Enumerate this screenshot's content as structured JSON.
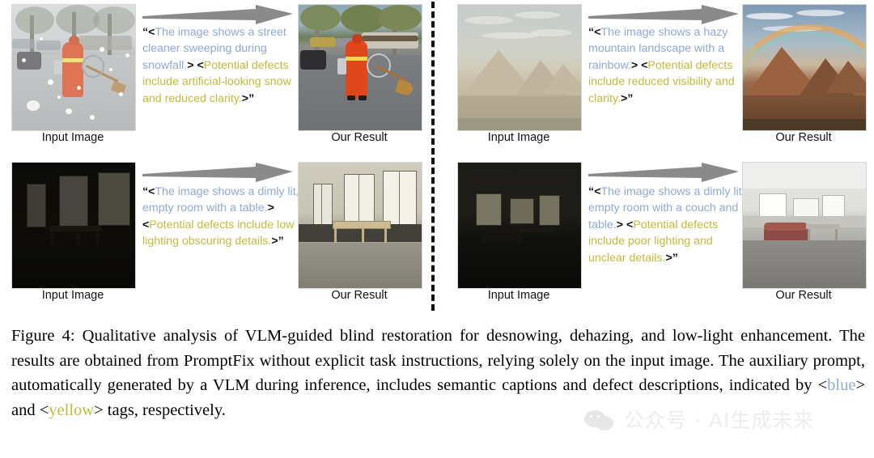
{
  "figure": {
    "panels": [
      {
        "id": "desnowing",
        "input_label": "Input Image",
        "result_label": "Our Result",
        "prompt": {
          "open_quote": "“",
          "caption_open": "<",
          "caption_text": "The image shows a street cleaner sweeping during snowfall.",
          "caption_close": ">",
          "defect_open": "<",
          "defect_text": "Potential defects include artificial-looking snow and reduced clarity.",
          "defect_close": ">",
          "close_quote": "”"
        }
      },
      {
        "id": "dehazing",
        "input_label": "Input Image",
        "result_label": "Our Result",
        "prompt": {
          "open_quote": "“",
          "caption_open": "<",
          "caption_text": "The image shows a hazy mountain landscape with a rainbow.",
          "caption_close": ">",
          "defect_open": "<",
          "defect_text": "Potential defects include reduced visibility and clarity.",
          "defect_close": ">",
          "close_quote": "”"
        }
      },
      {
        "id": "lowlight-table",
        "input_label": "Input Image",
        "result_label": "Our Result",
        "prompt": {
          "open_quote": "“",
          "caption_open": "<",
          "caption_text": "The image shows a dimly lit, empty room with a table.",
          "caption_close": ">",
          "defect_open": "<",
          "defect_text": "Potential defects include low lighting obscuring details.",
          "defect_close": ">",
          "close_quote": "”"
        }
      },
      {
        "id": "lowlight-couch",
        "input_label": "Input Image",
        "result_label": "Our Result",
        "prompt": {
          "open_quote": "“",
          "caption_open": "<",
          "caption_text": "The image shows a dimly lit, empty room with a couch and table.",
          "caption_close": ">",
          "defect_open": "<",
          "defect_text": "Potential defects include poor lighting and unclear details.",
          "defect_close": ">",
          "close_quote": "”"
        }
      }
    ]
  },
  "caption": {
    "part1": "Figure 4: Qualitative analysis of VLM-guided blind restoration for desnowing, dehazing, and low-light enhancement.  The results are obtained from PromptFix without explicit task instructions, relying solely on the input image. The auxiliary prompt, automatically generated by a VLM during inference, includes semantic captions and defect descriptions, indicated by <",
    "blue_tag": "blue",
    "part2": "> and <",
    "yellow_tag": "yellow",
    "part3": "> tags, respectively."
  },
  "watermark": {
    "text": "公众号 · AI生成未来"
  },
  "colors": {
    "blue_tag": "#8fa9d8",
    "yellow_tag": "#c1bb3a",
    "arrow": "#8a8a8a",
    "divider": "#111111"
  }
}
